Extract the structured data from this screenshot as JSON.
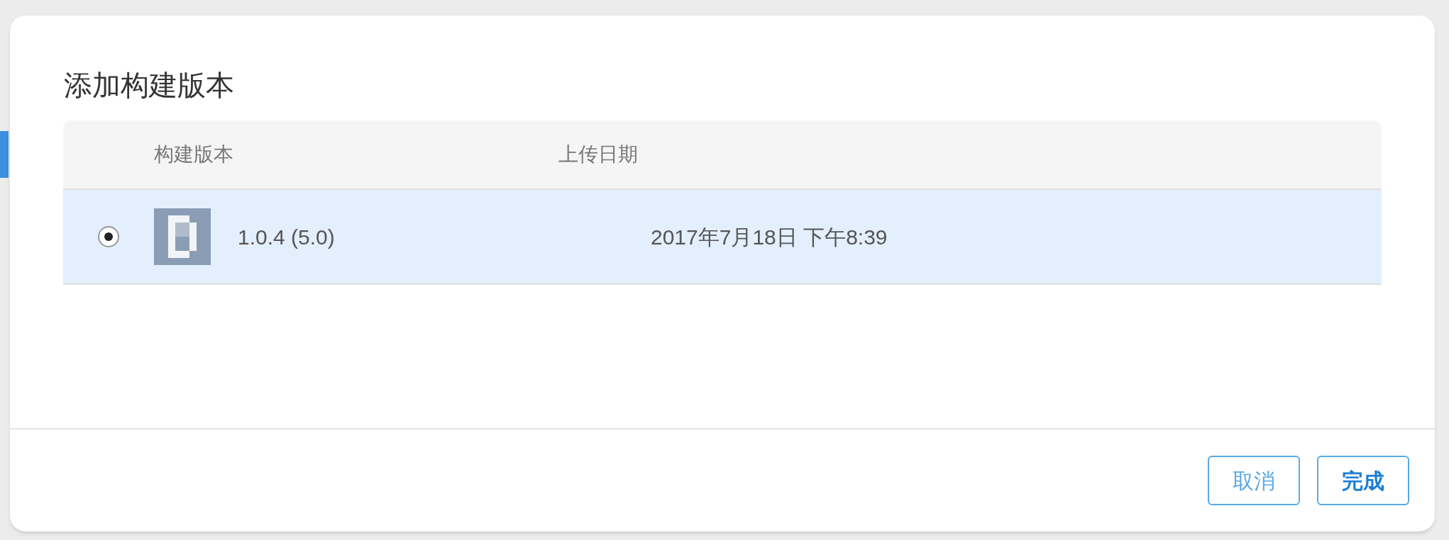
{
  "dialog": {
    "title": "添加构建版本"
  },
  "table": {
    "columns": [
      "构建版本",
      "上传日期"
    ],
    "rows": [
      {
        "selected": true,
        "build": "1.0.4 (5.0)",
        "uploaded": "2017年7月18日 下午8:39"
      }
    ]
  },
  "buttons": [
    {
      "label": "取消",
      "kind": "secondary"
    },
    {
      "label": "完成",
      "kind": "primary"
    }
  ]
}
